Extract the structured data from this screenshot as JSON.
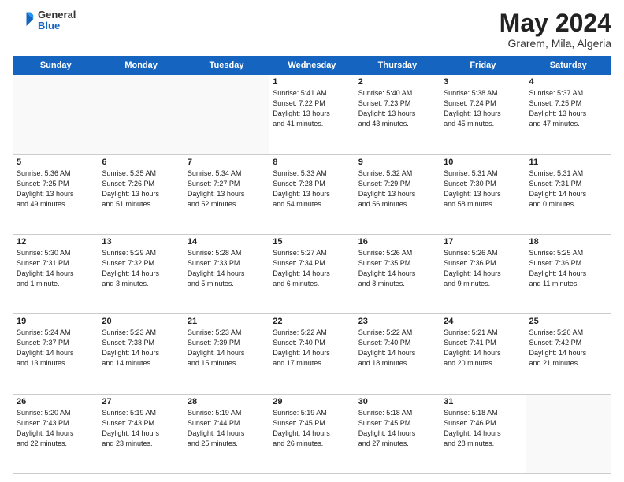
{
  "header": {
    "logo": {
      "general": "General",
      "blue": "Blue"
    },
    "title": "May 2024",
    "location": "Grarem, Mila, Algeria"
  },
  "days_of_week": [
    "Sunday",
    "Monday",
    "Tuesday",
    "Wednesday",
    "Thursday",
    "Friday",
    "Saturday"
  ],
  "weeks": [
    [
      {
        "day": "",
        "info": ""
      },
      {
        "day": "",
        "info": ""
      },
      {
        "day": "",
        "info": ""
      },
      {
        "day": "1",
        "info": "Sunrise: 5:41 AM\nSunset: 7:22 PM\nDaylight: 13 hours\nand 41 minutes."
      },
      {
        "day": "2",
        "info": "Sunrise: 5:40 AM\nSunset: 7:23 PM\nDaylight: 13 hours\nand 43 minutes."
      },
      {
        "day": "3",
        "info": "Sunrise: 5:38 AM\nSunset: 7:24 PM\nDaylight: 13 hours\nand 45 minutes."
      },
      {
        "day": "4",
        "info": "Sunrise: 5:37 AM\nSunset: 7:25 PM\nDaylight: 13 hours\nand 47 minutes."
      }
    ],
    [
      {
        "day": "5",
        "info": "Sunrise: 5:36 AM\nSunset: 7:25 PM\nDaylight: 13 hours\nand 49 minutes."
      },
      {
        "day": "6",
        "info": "Sunrise: 5:35 AM\nSunset: 7:26 PM\nDaylight: 13 hours\nand 51 minutes."
      },
      {
        "day": "7",
        "info": "Sunrise: 5:34 AM\nSunset: 7:27 PM\nDaylight: 13 hours\nand 52 minutes."
      },
      {
        "day": "8",
        "info": "Sunrise: 5:33 AM\nSunset: 7:28 PM\nDaylight: 13 hours\nand 54 minutes."
      },
      {
        "day": "9",
        "info": "Sunrise: 5:32 AM\nSunset: 7:29 PM\nDaylight: 13 hours\nand 56 minutes."
      },
      {
        "day": "10",
        "info": "Sunrise: 5:31 AM\nSunset: 7:30 PM\nDaylight: 13 hours\nand 58 minutes."
      },
      {
        "day": "11",
        "info": "Sunrise: 5:31 AM\nSunset: 7:31 PM\nDaylight: 14 hours\nand 0 minutes."
      }
    ],
    [
      {
        "day": "12",
        "info": "Sunrise: 5:30 AM\nSunset: 7:31 PM\nDaylight: 14 hours\nand 1 minute."
      },
      {
        "day": "13",
        "info": "Sunrise: 5:29 AM\nSunset: 7:32 PM\nDaylight: 14 hours\nand 3 minutes."
      },
      {
        "day": "14",
        "info": "Sunrise: 5:28 AM\nSunset: 7:33 PM\nDaylight: 14 hours\nand 5 minutes."
      },
      {
        "day": "15",
        "info": "Sunrise: 5:27 AM\nSunset: 7:34 PM\nDaylight: 14 hours\nand 6 minutes."
      },
      {
        "day": "16",
        "info": "Sunrise: 5:26 AM\nSunset: 7:35 PM\nDaylight: 14 hours\nand 8 minutes."
      },
      {
        "day": "17",
        "info": "Sunrise: 5:26 AM\nSunset: 7:36 PM\nDaylight: 14 hours\nand 9 minutes."
      },
      {
        "day": "18",
        "info": "Sunrise: 5:25 AM\nSunset: 7:36 PM\nDaylight: 14 hours\nand 11 minutes."
      }
    ],
    [
      {
        "day": "19",
        "info": "Sunrise: 5:24 AM\nSunset: 7:37 PM\nDaylight: 14 hours\nand 13 minutes."
      },
      {
        "day": "20",
        "info": "Sunrise: 5:23 AM\nSunset: 7:38 PM\nDaylight: 14 hours\nand 14 minutes."
      },
      {
        "day": "21",
        "info": "Sunrise: 5:23 AM\nSunset: 7:39 PM\nDaylight: 14 hours\nand 15 minutes."
      },
      {
        "day": "22",
        "info": "Sunrise: 5:22 AM\nSunset: 7:40 PM\nDaylight: 14 hours\nand 17 minutes."
      },
      {
        "day": "23",
        "info": "Sunrise: 5:22 AM\nSunset: 7:40 PM\nDaylight: 14 hours\nand 18 minutes."
      },
      {
        "day": "24",
        "info": "Sunrise: 5:21 AM\nSunset: 7:41 PM\nDaylight: 14 hours\nand 20 minutes."
      },
      {
        "day": "25",
        "info": "Sunrise: 5:20 AM\nSunset: 7:42 PM\nDaylight: 14 hours\nand 21 minutes."
      }
    ],
    [
      {
        "day": "26",
        "info": "Sunrise: 5:20 AM\nSunset: 7:43 PM\nDaylight: 14 hours\nand 22 minutes."
      },
      {
        "day": "27",
        "info": "Sunrise: 5:19 AM\nSunset: 7:43 PM\nDaylight: 14 hours\nand 23 minutes."
      },
      {
        "day": "28",
        "info": "Sunrise: 5:19 AM\nSunset: 7:44 PM\nDaylight: 14 hours\nand 25 minutes."
      },
      {
        "day": "29",
        "info": "Sunrise: 5:19 AM\nSunset: 7:45 PM\nDaylight: 14 hours\nand 26 minutes."
      },
      {
        "day": "30",
        "info": "Sunrise: 5:18 AM\nSunset: 7:45 PM\nDaylight: 14 hours\nand 27 minutes."
      },
      {
        "day": "31",
        "info": "Sunrise: 5:18 AM\nSunset: 7:46 PM\nDaylight: 14 hours\nand 28 minutes."
      },
      {
        "day": "",
        "info": ""
      }
    ]
  ]
}
